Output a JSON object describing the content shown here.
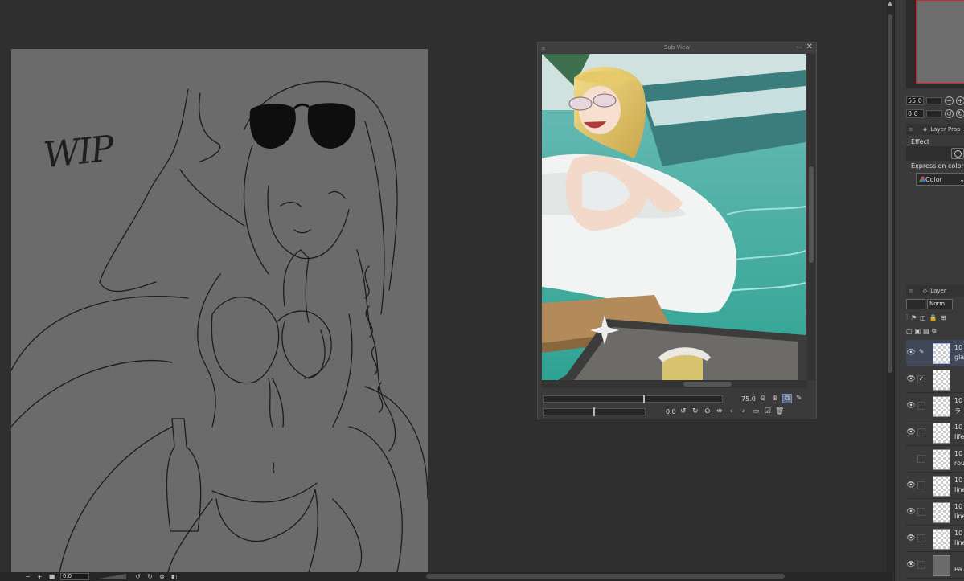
{
  "canvas": {
    "watermark_text": "WIP"
  },
  "subview": {
    "title": "Sub View",
    "zoom_value": "75.0",
    "rotation_value": "0.0"
  },
  "statusbar": {
    "zoom_field": "0.0"
  },
  "navigator": {
    "zoom_value": "55.0",
    "rotation_value": "0.0"
  },
  "layer_property": {
    "title": "Layer Prop",
    "effect_label": "Effect",
    "expression_color_label": "Expression color",
    "color_mode": "Color"
  },
  "layers_panel": {
    "title": "Layer",
    "blend_mode": "Norm",
    "layers": [
      {
        "opacity": "10",
        "name": "gla",
        "visible": true,
        "selected": true,
        "thumb": "transparent",
        "lock": "pen"
      },
      {
        "opacity": "",
        "name": "",
        "visible": true,
        "selected": false,
        "thumb": "transparent",
        "lock": "check"
      },
      {
        "opacity": "10",
        "name": "ラ",
        "visible": true,
        "selected": false,
        "thumb": "transparent",
        "lock": ""
      },
      {
        "opacity": "10",
        "name": "life",
        "visible": true,
        "selected": false,
        "thumb": "transparent",
        "lock": ""
      },
      {
        "opacity": "10",
        "name": "rou",
        "visible": false,
        "selected": false,
        "thumb": "transparent",
        "lock": ""
      },
      {
        "opacity": "10",
        "name": "line",
        "visible": true,
        "selected": false,
        "thumb": "transparent",
        "lock": ""
      },
      {
        "opacity": "10",
        "name": "line",
        "visible": true,
        "selected": false,
        "thumb": "transparent",
        "lock": ""
      },
      {
        "opacity": "10",
        "name": "line",
        "visible": true,
        "selected": false,
        "thumb": "transparent",
        "lock": ""
      },
      {
        "opacity": "",
        "name": "Pa",
        "visible": true,
        "selected": false,
        "thumb": "solid",
        "lock": ""
      }
    ]
  },
  "colors": {
    "app_bg": "#2f2f2f",
    "panel_bg": "#3a3a3a",
    "canvas_bg": "#6b6b6b",
    "selected_layer": "#3f4759",
    "navigator_frame": "#dd2222"
  }
}
